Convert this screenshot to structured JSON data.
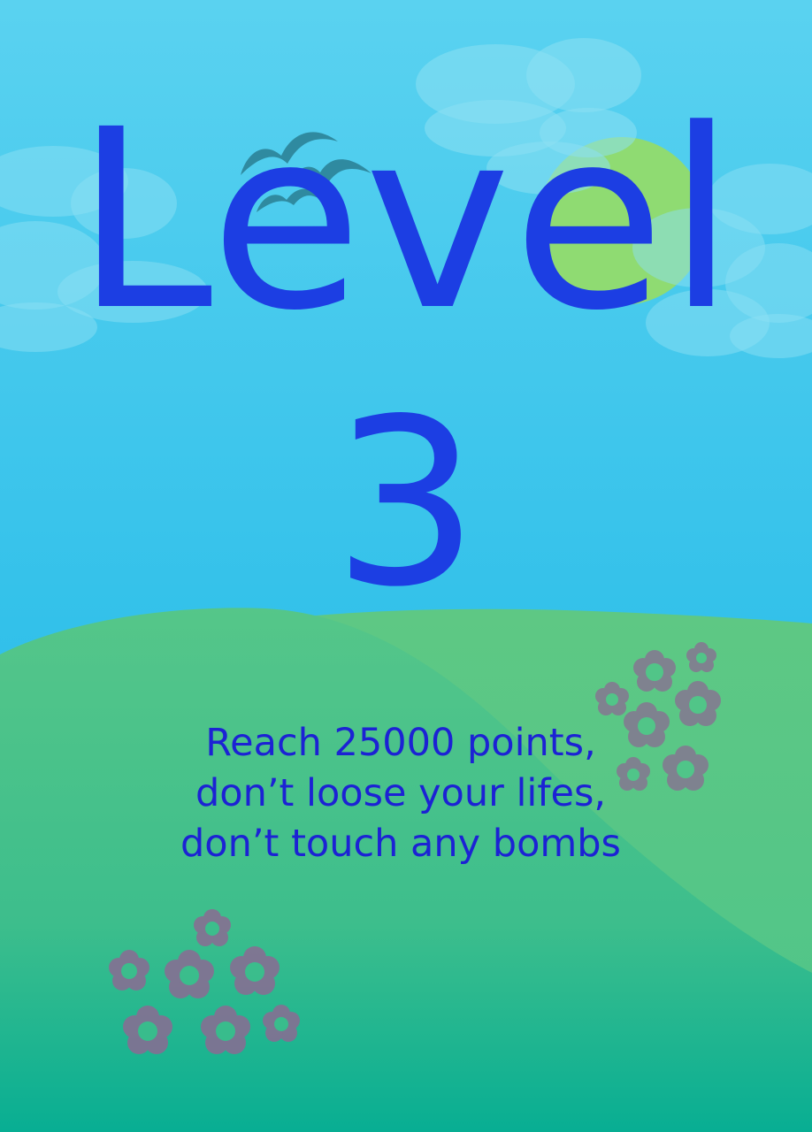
{
  "screen": {
    "heading": "Level",
    "level_number": "3",
    "objectives": [
      "Reach 25000 points,",
      "don’t loose your lifes,",
      "don’t touch any bombs"
    ]
  },
  "decorations": {
    "sky_top_color": "#58d1f0",
    "sky_bottom_color": "#2cbce8",
    "sun_color": "#8fdb72",
    "hill_color": "#4ec58a",
    "flower_color": "#8b6b93",
    "bird_color": "#2f8aa0",
    "icons": [
      "cloud-icon",
      "sun-icon",
      "bird-icon",
      "hill-icon",
      "flower-icon"
    ]
  }
}
